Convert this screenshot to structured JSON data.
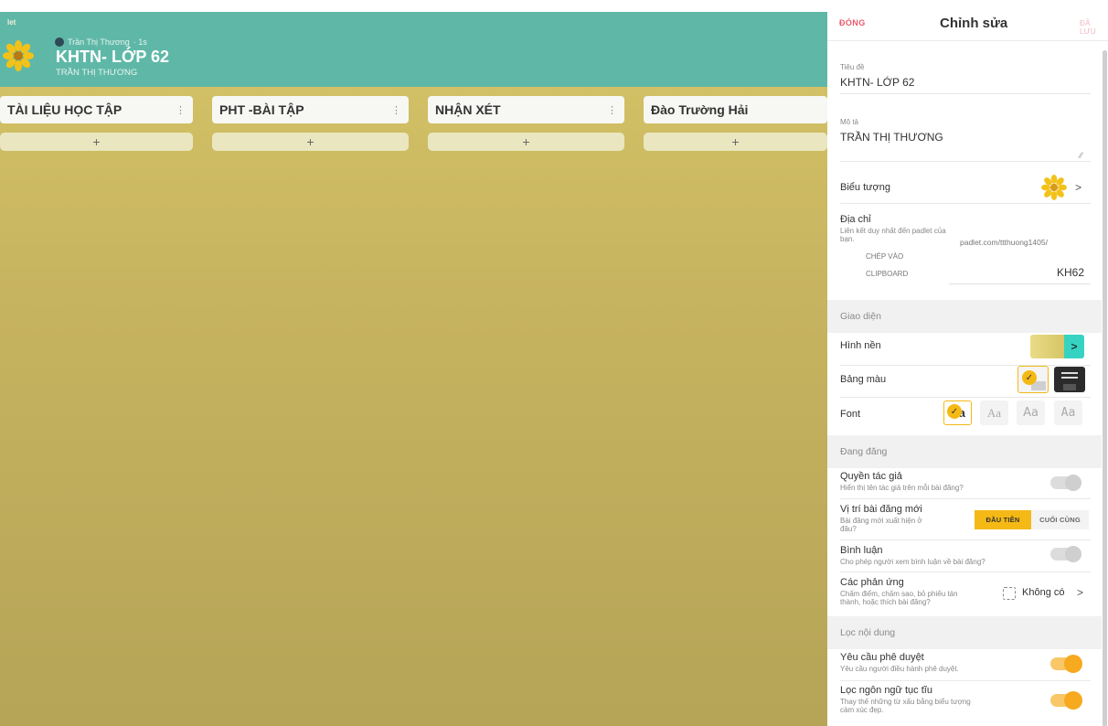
{
  "board": {
    "logo_fragment": "let",
    "author": "Trần Thị Thương",
    "time": "· 1s",
    "title": "KHTN- LỚP 62",
    "subtitle": "TRẦN THỊ THƯƠNG",
    "columns": [
      {
        "title": "TÀI LIỆU HỌC TẬP",
        "menu": "⋮",
        "add": "+"
      },
      {
        "title": "PHT -BÀI TẬP",
        "menu": "⋮",
        "add": "+"
      },
      {
        "title": "NHẬN XÉT",
        "menu": "⋮",
        "add": "+"
      },
      {
        "title": "Đào Trường Hải",
        "menu": "",
        "add": "+"
      }
    ]
  },
  "panel": {
    "close": "ĐÓNG",
    "title": "Chỉnh sửa",
    "saved": "ĐÃ LƯU",
    "title_field": {
      "label": "Tiêu đề",
      "value": "KHTN- LỚP 62"
    },
    "description_field": {
      "label": "Mô tả",
      "value": "TRẦN THỊ THƯƠNG"
    },
    "icon_row": {
      "label": "Biểu tượng",
      "chevron": ">"
    },
    "address": {
      "label": "Địa chỉ",
      "help": "Liên kết duy nhất đến padlet của bạn.",
      "base_url": "padlet.com/ttthuong1405/",
      "copy_line1": "CHÉP VÀO",
      "copy_line2": "CLIPBOARD",
      "slug": "KH62"
    },
    "appearance": {
      "heading": "Giao diện",
      "wallpaper_label": "Hình nền",
      "wallpaper_chevron": ">",
      "palette_label": "Bảng màu",
      "font_label": "Font",
      "font_options": [
        "Aa",
        "Aa",
        "Aa",
        "Aa"
      ],
      "check": "✓"
    },
    "posting": {
      "heading": "Đang đăng",
      "attribution_label": "Quyền tác giả",
      "attribution_help": "Hiển thị tên tác giả trên mỗi bài đăng?",
      "attribution_on": false,
      "position_label": "Vị trí bài đăng mới",
      "position_help": "Bài đăng mới xuất hiện ở đâu?",
      "position_options": [
        "ĐẦU TIÊN",
        "CUỐI CÙNG"
      ],
      "position_selected": "ĐẦU TIÊN",
      "comments_label": "Bình luận",
      "comments_help": "Cho phép người xem bình luận về bài đăng?",
      "comments_on": false,
      "reactions_label": "Các phản ứng",
      "reactions_help": "Chấm điểm, chấm sao, bỏ phiếu tán thành, hoặc thích bài đăng?",
      "reactions_value": "Không có",
      "reactions_chevron": ">"
    },
    "content_filter": {
      "heading": "Lọc nội dung",
      "approval_label": "Yêu cầu phê duyệt",
      "approval_help": "Yêu cầu người điều hành phê duyệt.",
      "approval_on": true,
      "profanity_label": "Lọc ngôn ngữ tục tĩu",
      "profanity_help": "Thay thế những từ xấu bằng biểu tượng cảm xúc đẹp.",
      "profanity_on": true
    },
    "colors": {
      "accent": "#f5b916",
      "close": "#e85a6c",
      "header": "#5fb8a7",
      "wallpaper_arrow": "#37d3c2"
    }
  }
}
